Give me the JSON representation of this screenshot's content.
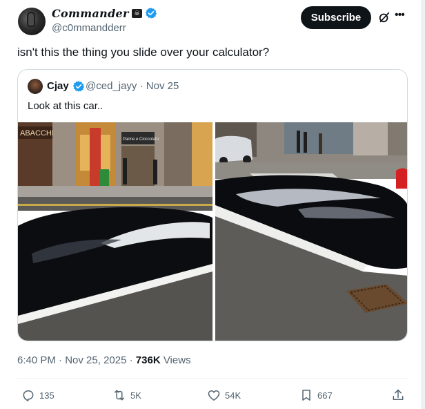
{
  "author": {
    "display_name": "Commander",
    "handle": "@c0mmandderr",
    "badge_icon": "pirate-flag-icon",
    "verified": true
  },
  "header": {
    "subscribe_label": "Subscribe",
    "grok_icon": "grok-icon",
    "more_icon": "more-icon"
  },
  "tweet": {
    "text": "isn't this the thing you slide over your calculator?"
  },
  "quote": {
    "name": "Cjay",
    "handle": "@ced_jayy",
    "separator": " · ",
    "date": "Nov 25",
    "text": "Look at this car..",
    "store_sign": "ABACCHI",
    "shop_sign": "Panne e Cioccolato"
  },
  "meta": {
    "time": "6:40 PM",
    "separator": " · ",
    "date": "Nov 25, 2025",
    "views_count": "736K",
    "views_label": " Views"
  },
  "actions": {
    "replies": "135",
    "reposts": "5K",
    "likes": "54K",
    "bookmarks": "667"
  },
  "colors": {
    "accent": "#1d9bf0",
    "text_primary": "#0f1419",
    "text_secondary": "#536471",
    "border": "#cfd9de",
    "button_bg": "#0f1419"
  }
}
